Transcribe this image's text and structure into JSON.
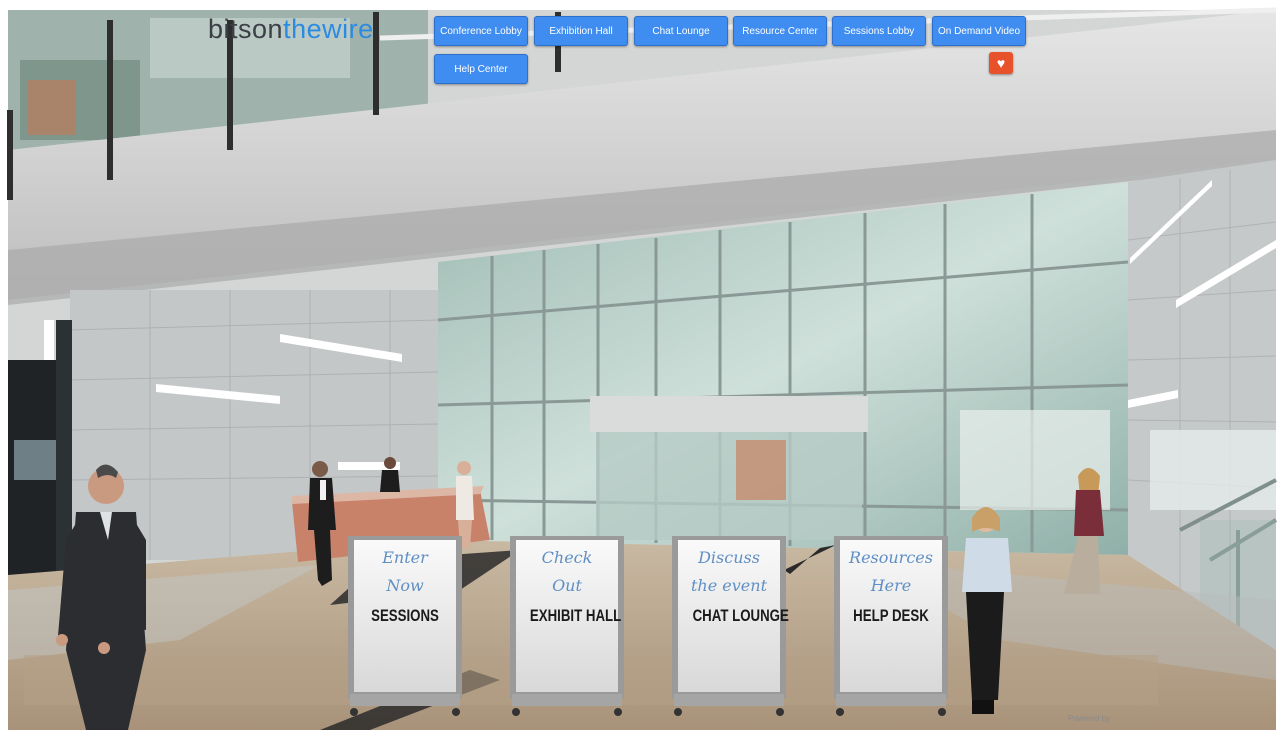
{
  "logo": {
    "part_a": "bitson",
    "part_b": "thewire"
  },
  "nav": {
    "buttons": [
      "Conference Lobby",
      "Exhibition Hall",
      "Chat Lounge",
      "Resource Center",
      "Sessions Lobby",
      "On Demand Video",
      "Help Center"
    ]
  },
  "heart_icon": "heart-icon",
  "signs": [
    {
      "heading_1": "Enter",
      "heading_2": "Now",
      "title": "SESSIONS"
    },
    {
      "heading_1": "Check",
      "heading_2": "Out",
      "title": "EXHIBIT HALL"
    },
    {
      "heading_1": "Discuss",
      "heading_2": "the event",
      "title": "CHAT LOUNGE"
    },
    {
      "heading_1": "Resources",
      "heading_2": "Here",
      "title": "HELP DESK"
    }
  ],
  "footer": {
    "powered_by": "Powered by"
  },
  "colors": {
    "nav_button": "#3f8df0",
    "heart_button": "#e8522b",
    "logo_dark": "#3b3f46",
    "logo_blue": "#2b8be0",
    "sign_script": "#5f8fc4"
  }
}
